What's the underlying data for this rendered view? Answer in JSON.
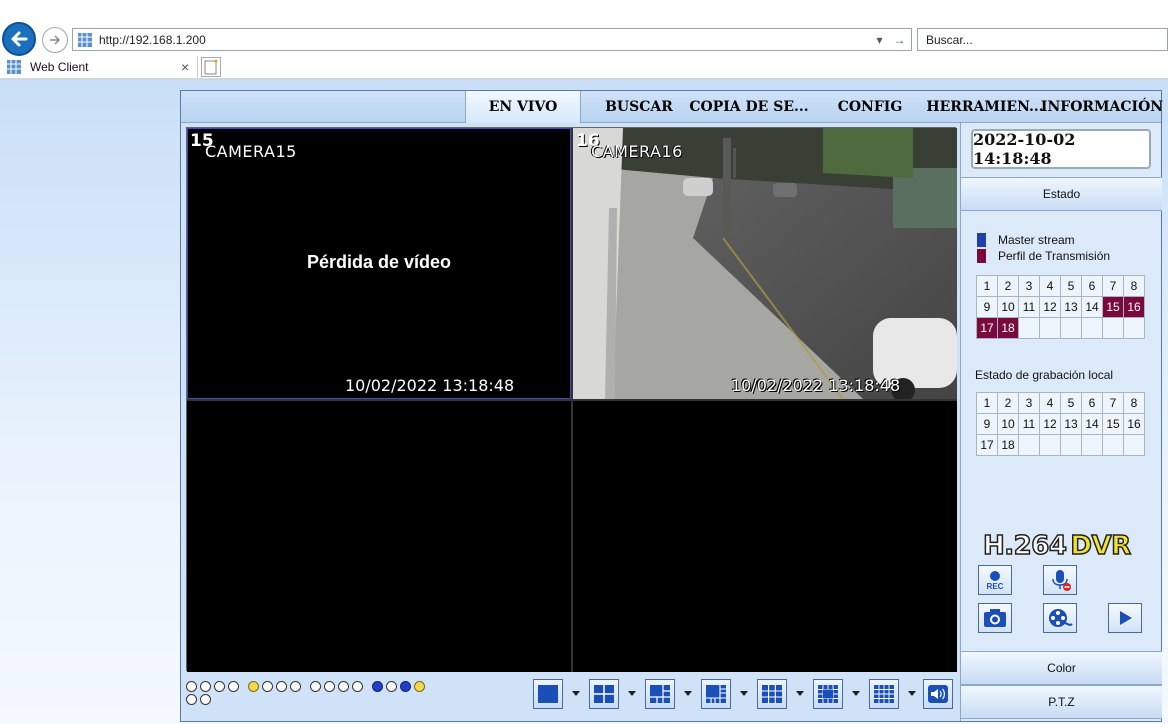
{
  "browser": {
    "address": "http://192.168.1.200",
    "search_placeholder": "Buscar...",
    "tab_title": "Web Client"
  },
  "nav": {
    "items": [
      {
        "label": "EN VIVO",
        "active": true
      },
      {
        "label": "BUSCAR",
        "active": false
      },
      {
        "label": "COPIA DE SE...",
        "active": false
      },
      {
        "label": "CONFIG",
        "active": false
      },
      {
        "label": "HERRAMIEN...",
        "active": false
      },
      {
        "label": "INFORMACIÓN",
        "active": false
      }
    ]
  },
  "cameras": {
    "cam15": {
      "number": "15",
      "name": "CAMERA15",
      "timestamp": "10/02/2022 13:18:48",
      "status": "Pérdida de vídeo"
    },
    "cam16": {
      "number": "16",
      "name": "CAMERA16",
      "timestamp": "10/02/2022 13:18:48"
    }
  },
  "panel": {
    "datetime": "2022-10-02 14:18:48",
    "estado_label": "Estado",
    "legend_master": "Master stream",
    "legend_profile": "Perfil de Transmisión",
    "master_color": "#2040a8",
    "profile_color": "#7a0a3e",
    "channels": [
      "1",
      "2",
      "3",
      "4",
      "5",
      "6",
      "7",
      "8",
      "9",
      "10",
      "11",
      "12",
      "13",
      "14",
      "15",
      "16",
      "17",
      "18"
    ],
    "highlighted_channels": [
      "15",
      "16",
      "17",
      "18"
    ],
    "recording_label": "Estado de grabación local",
    "recording_channels": [
      "1",
      "2",
      "3",
      "4",
      "5",
      "6",
      "7",
      "8",
      "9",
      "10",
      "11",
      "12",
      "13",
      "14",
      "15",
      "16",
      "17",
      "18"
    ],
    "logo_h264": "H.264",
    "logo_dvr": "DVR",
    "color_label": "Color",
    "ptz_label": "P.T.Z"
  }
}
